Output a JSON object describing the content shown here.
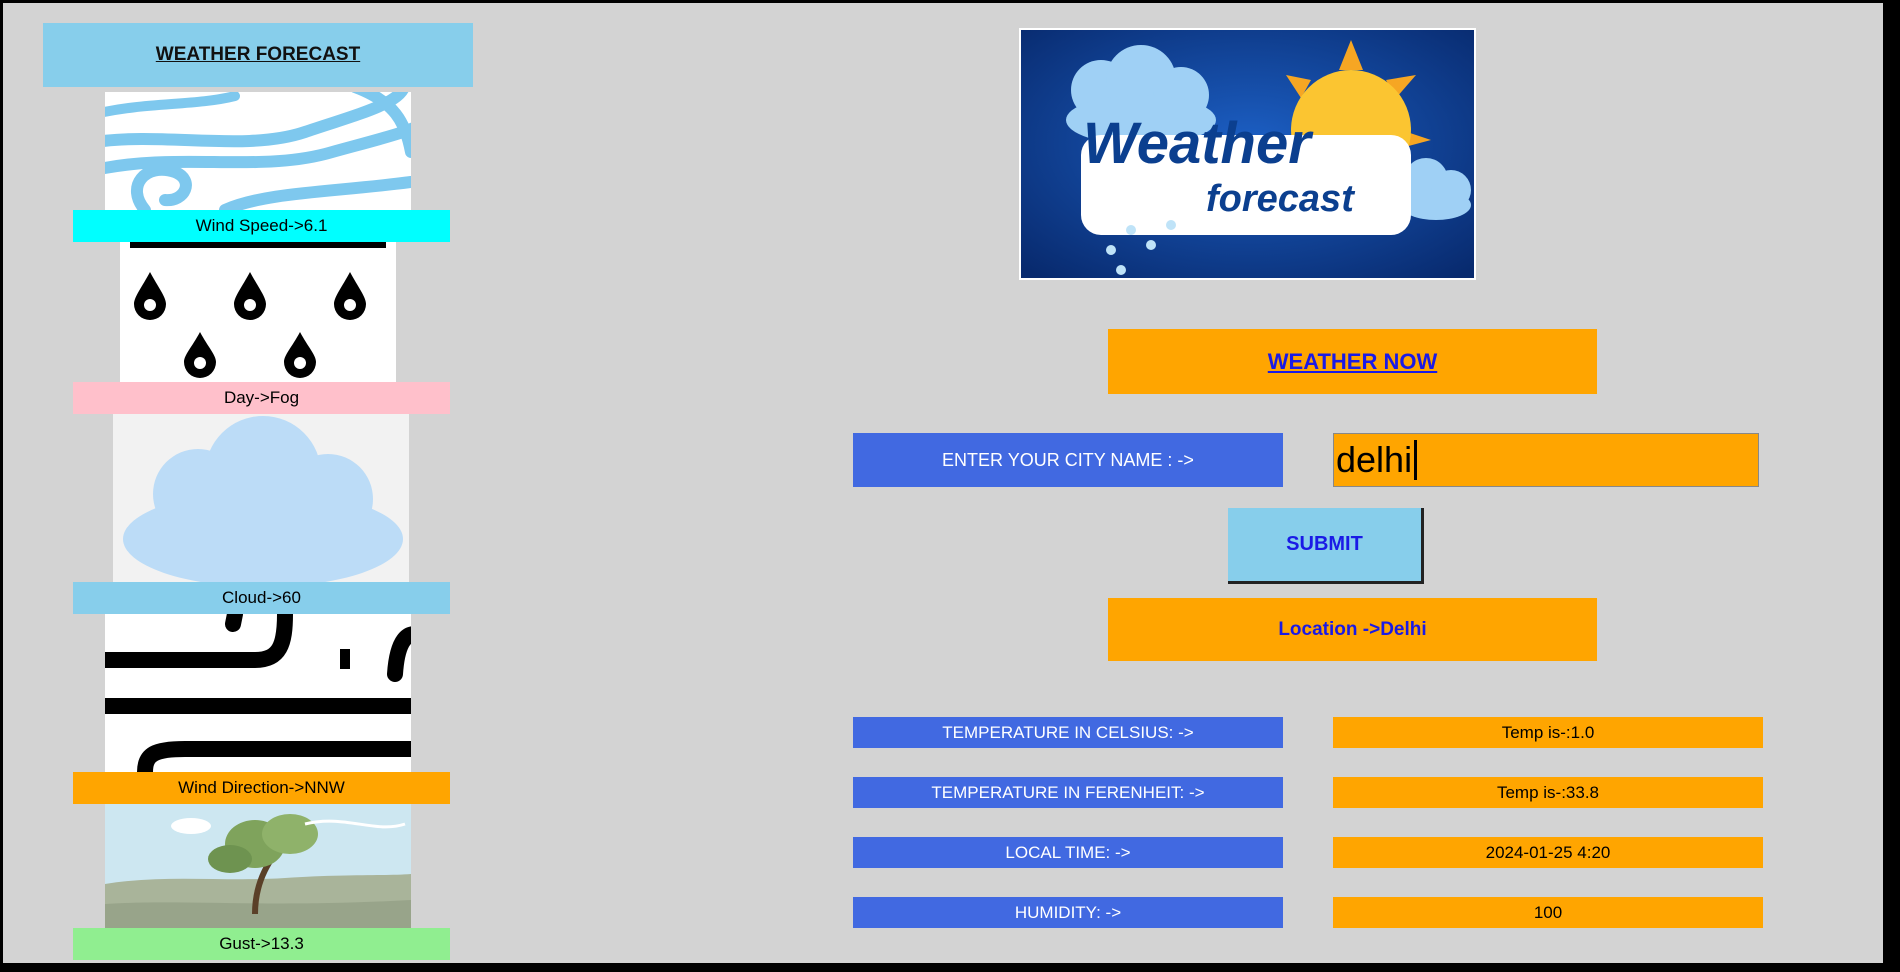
{
  "sidebar": {
    "title": "WEATHER  FORECAST",
    "items": [
      {
        "label": "Wind Speed->6.1",
        "color": "#00ffff",
        "icon": "wind-icon"
      },
      {
        "label": "Day->Fog",
        "color": "#ffc0cb",
        "icon": "rain-drops-icon"
      },
      {
        "label": "Cloud->60",
        "color": "#87ceeb",
        "icon": "cloud-icon"
      },
      {
        "label": "Wind Direction->NNW",
        "color": "#ffa500",
        "icon": "wind-direction-icon"
      },
      {
        "label": "Gust->13.3",
        "color": "#90ee90",
        "icon": "gust-tree-icon"
      }
    ]
  },
  "banner": {
    "text1": "Weather",
    "text2": "forecast"
  },
  "main": {
    "header": "WEATHER  NOW",
    "city_label": "ENTER YOUR CITY NAME : ->",
    "city_value": "delhi",
    "submit_label": "SUBMIT",
    "location": "Location ->Delhi",
    "rows": [
      {
        "label": "TEMPERATURE IN CELSIUS: ->",
        "value": "Temp is-:1.0"
      },
      {
        "label": "TEMPERATURE IN FERENHEIT: ->",
        "value": "Temp is-:33.8"
      },
      {
        "label": "LOCAL TIME: ->",
        "value": "2024-01-25 4:20"
      },
      {
        "label": "HUMIDITY: ->",
        "value": "100"
      }
    ]
  },
  "colors": {
    "accent_blue": "#4169e1",
    "accent_orange": "#ffa500",
    "sky": "#87ceeb",
    "background": "#d3d3d3"
  }
}
